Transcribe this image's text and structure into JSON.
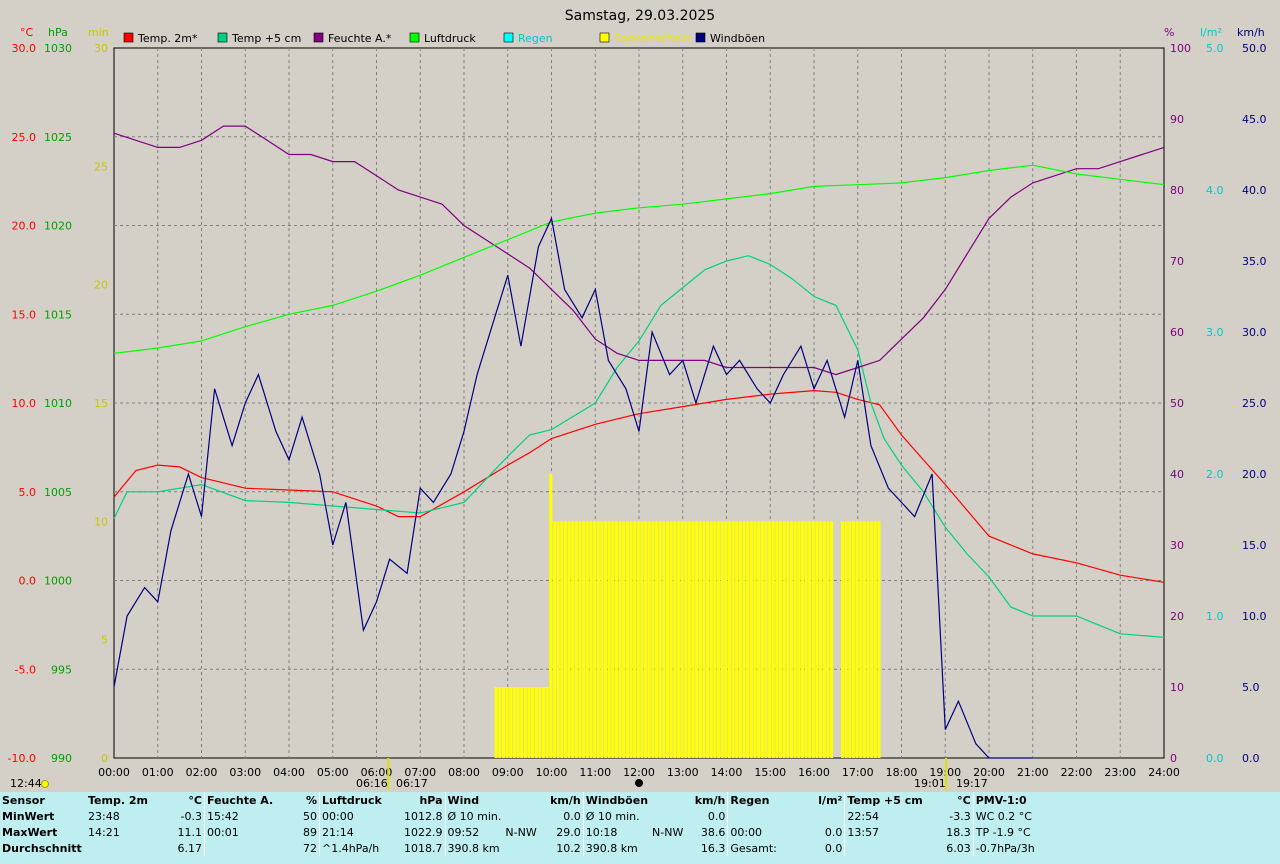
{
  "title": "Samstag, 29.03.2025",
  "colors": {
    "temp": "#ff0000",
    "temp5": "#00d080",
    "hum": "#800080",
    "press": "#00ff00",
    "rain": "#00ffff",
    "sun": "#ffff00",
    "gust": "#000080",
    "grid": "#808080"
  },
  "axis_units": {
    "temp": "°C",
    "press": "hPa",
    "sun": "min",
    "hum": "%",
    "rain": "l/m²",
    "wind": "km/h"
  },
  "legend": [
    {
      "label": "Temp. 2m*",
      "color": "#ff0000",
      "text_color": "#000000"
    },
    {
      "label": "Temp +5 cm",
      "color": "#00d080",
      "text_color": "#000000"
    },
    {
      "label": "Feuchte A.*",
      "color": "#800080",
      "text_color": "#000000"
    },
    {
      "label": "Luftdruck",
      "color": "#00ff00",
      "text_color": "#000000"
    },
    {
      "label": "Regen",
      "color": "#00ffff",
      "text_color": "#00c8c8"
    },
    {
      "label": "Sonnenschein",
      "color": "#ffff00",
      "text_color": "#e8e800"
    },
    {
      "label": "Windböen",
      "color": "#000080",
      "text_color": "#000000"
    }
  ],
  "chart_data": {
    "type": "line",
    "title": "Samstag, 29.03.2025",
    "x_ticks": [
      "00:00",
      "01:00",
      "02:00",
      "03:00",
      "04:00",
      "05:00",
      "06:00",
      "07:00",
      "08:00",
      "09:00",
      "10:00",
      "11:00",
      "12:00",
      "13:00",
      "14:00",
      "15:00",
      "16:00",
      "17:00",
      "18:00",
      "19:00",
      "20:00",
      "21:00",
      "22:00",
      "23:00",
      "24:00"
    ],
    "axes": {
      "temp_c": {
        "range": [
          -10,
          30
        ],
        "ticks": [
          "30.0",
          "25.0",
          "20.0",
          "15.0",
          "10.0",
          "5.0",
          "0.0",
          "-5.0",
          "-10.0"
        ]
      },
      "press_hpa": {
        "range": [
          990,
          1030
        ],
        "ticks": [
          "1030",
          "1025",
          "1020",
          "1015",
          "1010",
          "1005",
          "1000",
          "995",
          "990"
        ]
      },
      "sun_min": {
        "range": [
          0,
          30
        ],
        "ticks": [
          "30",
          "25",
          "20",
          "15",
          "10",
          "5",
          "0"
        ]
      },
      "hum_pct": {
        "range": [
          0,
          100
        ],
        "ticks": [
          "100",
          "90",
          "80",
          "70",
          "60",
          "50",
          "40",
          "30",
          "20",
          "10",
          "0"
        ]
      },
      "rain_l": {
        "range": [
          0,
          5
        ],
        "ticks": [
          "5.0",
          "4.0",
          "3.0",
          "2.0",
          "1.0",
          "0.0"
        ]
      },
      "wind_kmh": {
        "range": [
          0,
          50
        ],
        "ticks": [
          "50.0",
          "45.0",
          "40.0",
          "35.0",
          "30.0",
          "25.0",
          "20.0",
          "15.0",
          "10.0",
          "5.0",
          "0.0"
        ]
      }
    },
    "series": [
      {
        "name": "Temp. 2m*",
        "axis": "temp_c",
        "x": [
          0,
          0.5,
          1,
          1.5,
          2,
          3,
          4,
          5,
          6,
          6.5,
          7,
          8,
          9,
          9.5,
          10,
          11,
          12,
          13,
          14,
          15,
          16,
          16.5,
          17,
          17.5,
          18,
          19,
          20,
          21,
          22,
          23,
          24
        ],
        "y": [
          4.7,
          6.2,
          6.5,
          6.4,
          5.8,
          5.2,
          5.1,
          5.0,
          4.2,
          3.6,
          3.6,
          5.0,
          6.5,
          7.2,
          8.0,
          8.8,
          9.4,
          9.8,
          10.2,
          10.5,
          10.7,
          10.6,
          10.2,
          9.9,
          8.2,
          5.4,
          2.5,
          1.5,
          1.0,
          0.3,
          -0.1
        ]
      },
      {
        "name": "Temp +5 cm",
        "axis": "temp_c",
        "x": [
          0,
          0.3,
          1,
          2,
          3,
          4,
          5,
          6,
          7,
          8,
          8.5,
          9,
          9.5,
          10,
          11,
          11.5,
          12,
          12.5,
          13,
          13.5,
          14,
          14.5,
          15,
          15.5,
          16,
          16.5,
          17,
          17.3,
          17.6,
          18,
          18.5,
          19,
          19.5,
          20,
          20.5,
          21,
          22,
          22.5,
          23,
          24
        ],
        "y": [
          3.5,
          5.0,
          5.0,
          5.4,
          4.5,
          4.4,
          4.2,
          4.0,
          3.8,
          4.4,
          5.7,
          7.0,
          8.2,
          8.5,
          10.0,
          12.0,
          13.5,
          15.5,
          16.5,
          17.5,
          18.0,
          18.3,
          17.8,
          17.0,
          16.0,
          15.5,
          13.0,
          10.0,
          8.0,
          6.5,
          5.0,
          3.0,
          1.5,
          0.2,
          -1.5,
          -2.0,
          -2.0,
          -2.5,
          -3.0,
          -3.2
        ]
      },
      {
        "name": "Feuchte A.*",
        "axis": "hum_pct",
        "x": [
          0,
          0.5,
          1,
          1.5,
          2,
          2.5,
          3,
          3.5,
          4,
          4.5,
          5,
          5.5,
          6,
          6.5,
          7,
          7.5,
          8,
          8.5,
          9,
          9.5,
          10,
          10.5,
          11,
          11.5,
          12,
          12.5,
          13,
          13.5,
          14,
          14.5,
          15,
          15.5,
          16,
          16.5,
          17,
          17.5,
          18,
          18.5,
          19,
          19.5,
          20,
          20.5,
          21,
          21.5,
          22,
          22.5,
          23,
          23.5,
          24
        ],
        "y": [
          88,
          87,
          86,
          86,
          87,
          89,
          89,
          87,
          85,
          85,
          84,
          84,
          82,
          80,
          79,
          78,
          75,
          73,
          71,
          69,
          66,
          63,
          59,
          57,
          56,
          56,
          56,
          56,
          55,
          55,
          55,
          55,
          55,
          54,
          55,
          56,
          59,
          62,
          66,
          71,
          76,
          79,
          81,
          82,
          83,
          83,
          84,
          85,
          86
        ]
      },
      {
        "name": "Luftdruck",
        "axis": "press_hpa",
        "x": [
          0,
          1,
          2,
          3,
          4,
          5,
          6,
          7,
          8,
          9,
          10,
          11,
          12,
          13,
          14,
          15,
          16,
          17,
          18,
          19,
          20,
          21,
          22,
          23,
          24
        ],
        "y": [
          1012.8,
          1013.1,
          1013.5,
          1014.3,
          1015.0,
          1015.5,
          1016.3,
          1017.2,
          1018.2,
          1019.2,
          1020.2,
          1020.7,
          1021.0,
          1021.2,
          1021.5,
          1021.8,
          1022.2,
          1022.3,
          1022.4,
          1022.7,
          1023.1,
          1023.4,
          1022.9,
          1022.6,
          1022.3
        ]
      },
      {
        "name": "Windböen",
        "axis": "wind_kmh",
        "x": [
          0,
          0.3,
          0.7,
          1,
          1.3,
          1.7,
          2,
          2.3,
          2.7,
          3,
          3.3,
          3.7,
          4,
          4.3,
          4.7,
          5,
          5.3,
          5.7,
          6,
          6.3,
          6.7,
          7,
          7.3,
          7.7,
          8,
          8.3,
          8.7,
          9,
          9.3,
          9.7,
          10,
          10.3,
          10.7,
          11,
          11.3,
          11.7,
          12,
          12.3,
          12.7,
          13,
          13.3,
          13.7,
          14,
          14.3,
          14.7,
          15,
          15.3,
          15.7,
          16,
          16.3,
          16.7,
          17,
          17.3,
          17.7,
          18,
          18.3,
          18.7,
          19,
          19.3,
          19.7,
          20,
          20.5,
          21
        ],
        "y": [
          5,
          10,
          12,
          11,
          16,
          20,
          17,
          26,
          22,
          25,
          27,
          23,
          21,
          24,
          20,
          15,
          18,
          9,
          11,
          14,
          13,
          19,
          18,
          20,
          23,
          27,
          31,
          34,
          29,
          36,
          38,
          33,
          31,
          33,
          28,
          26,
          23,
          30,
          27,
          28,
          25,
          29,
          27,
          28,
          26,
          25,
          27,
          29,
          26,
          28,
          24,
          28,
          22,
          19,
          18,
          17,
          20,
          2,
          4,
          1,
          0,
          0,
          0
        ]
      }
    ],
    "sunshine": {
      "name": "Sonnenschein",
      "axis": "sun_min",
      "x_start": 8.7,
      "x_end": 17.5,
      "values": [
        {
          "x": 8.7,
          "y": 3
        },
        {
          "x": 9.2,
          "y": 3
        },
        {
          "x": 9.8,
          "y": 3
        },
        {
          "x": 9.88,
          "y": 12
        },
        {
          "x": 10.0,
          "y": 10
        },
        {
          "x": 17.5,
          "y": 10
        }
      ]
    },
    "markers": {
      "sunrise": "06:16",
      "sunrise2": "06:17",
      "noon": "12:00",
      "sunset": "19:01",
      "sunset2": "19:17",
      "left_label": "12:44"
    }
  },
  "summary": {
    "headers": [
      "Sensor",
      "Temp. 2m",
      "°C",
      "Feuchte A.",
      "%",
      "Luftdruck",
      "hPa",
      "Wind",
      "km/h",
      "Windböen",
      "km/h",
      "Regen",
      "l/m²",
      "Temp +5 cm",
      "°C",
      "PMV-1:0"
    ],
    "row_labels": [
      "MinWert",
      "MaxWert",
      "Durchschnitt"
    ],
    "temp": [
      [
        "23:48",
        "-0.3"
      ],
      [
        "14:21",
        "11.1"
      ],
      [
        "",
        "6.17"
      ]
    ],
    "hum": [
      [
        "15:42",
        "50"
      ],
      [
        "00:01",
        "89"
      ],
      [
        "",
        "72"
      ]
    ],
    "press": [
      [
        "00:00",
        "1012.8"
      ],
      [
        "21:14",
        "1022.9"
      ],
      [
        "^1.4hPa/h",
        "1018.7"
      ]
    ],
    "wind": [
      [
        "Ø 10 min.",
        "",
        "0.0"
      ],
      [
        "09:52",
        "N-NW",
        "29.0"
      ],
      [
        "390.8 km",
        "",
        "10.2"
      ]
    ],
    "gust": [
      [
        "Ø 10 min.",
        "",
        "0.0"
      ],
      [
        "10:18",
        "N-NW",
        "38.6"
      ],
      [
        "390.8 km",
        "",
        "16.3"
      ]
    ],
    "rain": [
      [
        "",
        ""
      ],
      [
        "00:00",
        "0.0"
      ],
      [
        "Gesamt:",
        "0.0"
      ]
    ],
    "temp5": [
      [
        "22:54",
        "-3.3"
      ],
      [
        "13:57",
        "18.3"
      ],
      [
        "",
        "6.03"
      ]
    ],
    "pmv": [
      "WC 0.2 °C",
      "TP -1.9 °C",
      "-0.7hPa/3h"
    ]
  }
}
